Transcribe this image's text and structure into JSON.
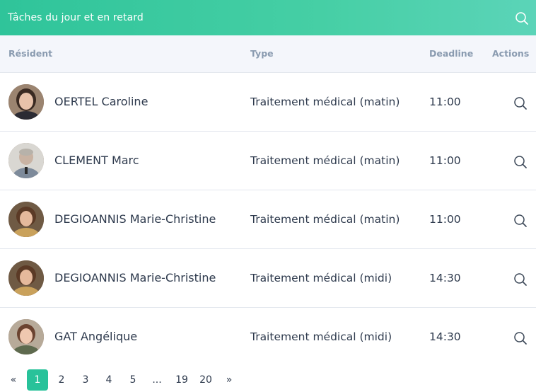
{
  "header": {
    "title": "Tâches du jour et en retard",
    "search_icon": "search-icon"
  },
  "columns": {
    "resident": "Résident",
    "type": "Type",
    "deadline": "Deadline",
    "actions": "Actions"
  },
  "rows": [
    {
      "name": "OERTEL Caroline",
      "type": "Traitement médical (matin)",
      "deadline": "11:00",
      "action_icon": "search-icon"
    },
    {
      "name": "CLEMENT Marc",
      "type": "Traitement médical (matin)",
      "deadline": "11:00",
      "action_icon": "search-icon"
    },
    {
      "name": "DEGIOANNIS Marie-Christine",
      "type": "Traitement médical (matin)",
      "deadline": "11:00",
      "action_icon": "search-icon"
    },
    {
      "name": "DEGIOANNIS Marie-Christine",
      "type": "Traitement médical (midi)",
      "deadline": "14:30",
      "action_icon": "search-icon"
    },
    {
      "name": "GAT Angélique",
      "type": "Traitement médical (midi)",
      "deadline": "14:30",
      "action_icon": "search-icon"
    }
  ],
  "pagination": {
    "prev": "«",
    "next": "»",
    "pages": [
      "1",
      "2",
      "3",
      "4",
      "5",
      "...",
      "19",
      "20"
    ],
    "current": "1"
  },
  "colors": {
    "accent": "#2fc49a",
    "header_bg": "#f4f6fb",
    "text": "#2e3a4d",
    "muted": "#8a9bb0"
  }
}
